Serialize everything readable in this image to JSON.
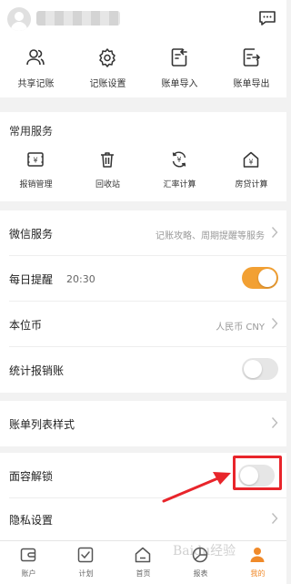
{
  "header": {
    "message_icon": "message-icon"
  },
  "quick_actions": [
    {
      "label": "共享记账",
      "icon": "users-icon"
    },
    {
      "label": "记账设置",
      "icon": "gear-icon"
    },
    {
      "label": "账单导入",
      "icon": "import-icon"
    },
    {
      "label": "账单导出",
      "icon": "export-icon"
    }
  ],
  "common_services": {
    "title": "常用服务",
    "items": [
      {
        "label": "报销管理",
        "icon": "reimburse-icon"
      },
      {
        "label": "回收站",
        "icon": "trash-icon"
      },
      {
        "label": "汇率计算",
        "icon": "exchange-icon"
      },
      {
        "label": "房贷计算",
        "icon": "house-loan-icon"
      }
    ]
  },
  "rows": {
    "wechat": {
      "label": "微信服务",
      "value": "记账攻略、周期提醒等服务"
    },
    "daily_reminder": {
      "label": "每日提醒",
      "time": "20:30",
      "enabled": true
    },
    "currency": {
      "label": "本位币",
      "value": "人民币 CNY"
    },
    "reimburse_stats": {
      "label": "统计报销账",
      "enabled": false
    },
    "bill_style": {
      "label": "账单列表样式"
    },
    "face_unlock": {
      "label": "面容解锁",
      "enabled": false
    },
    "privacy": {
      "label": "隐私设置"
    }
  },
  "bottom_nav": [
    {
      "label": "账户",
      "icon": "wallet-icon",
      "active": false
    },
    {
      "label": "计划",
      "icon": "check-square-icon",
      "active": false
    },
    {
      "label": "首页",
      "icon": "home-icon",
      "active": false
    },
    {
      "label": "报表",
      "icon": "chart-icon",
      "active": false
    },
    {
      "label": "我的",
      "icon": "person-icon",
      "active": true
    }
  ],
  "watermark": "Baidu经验",
  "colors": {
    "accent": "#f2a033",
    "highlight": "#e8252b",
    "active_tab": "#f08a2a"
  }
}
